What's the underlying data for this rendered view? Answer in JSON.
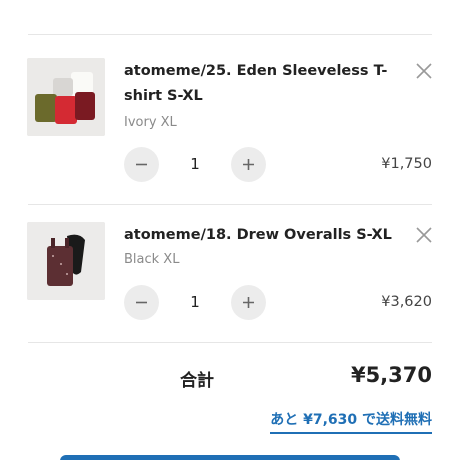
{
  "cart": {
    "items": [
      {
        "title": "atomeme/25. Eden Sleeveless T-shirt S-XL",
        "variant": "Ivory XL",
        "quantity": "1",
        "price": "¥1,750",
        "image_icon": "sleeveless-shirts-photo"
      },
      {
        "title": "atomeme/18. Drew Overalls S-XL",
        "variant": "Black XL",
        "quantity": "1",
        "price": "¥3,620",
        "image_icon": "overalls-photo"
      }
    ],
    "controls": {
      "remove_icon": "close-icon",
      "decrement_icon": "minus-icon",
      "increment_icon": "plus-icon"
    }
  },
  "summary": {
    "total_label": "合計",
    "total_value": "¥5,370",
    "free_shipping_link": "あと ¥7,630 で送料無料"
  },
  "colors": {
    "accent": "#1f6fb5",
    "button_bg": "#ececec"
  }
}
